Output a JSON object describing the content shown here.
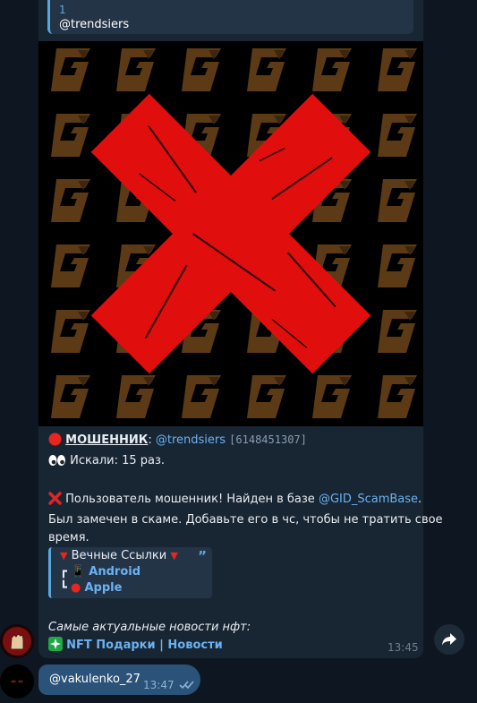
{
  "reply": {
    "number": "1",
    "username": "@trendsiers"
  },
  "image": {
    "icon": "red-x-scam-icon",
    "tile_letter": "G",
    "tile_color": "#5c3a15",
    "x_color": "#e10e0e"
  },
  "message": {
    "line1_label": "МОШЕННИК",
    "line1_colon": ":",
    "line1_user": "@trendsiers",
    "line1_id": "[6148451307]",
    "line2": "Искали: 15 раз.",
    "line3_pre": "Пользователь мошенник! Найден в базе ",
    "line3_link": "@GID_ScamBase",
    "line3_post": ".",
    "line4": "Был замечен в скаме. Добавьте его в чс, чтобы не тратить свое",
    "line5": "время.",
    "quote_title": "Вечные Ссылки",
    "quote_android": "Android",
    "quote_apple": "Apple",
    "news_italic": "Самые актуальные новости нфт:",
    "news_link": "NFT Подарки | Новости",
    "time": "13:45"
  },
  "reply_message": {
    "text": "@vakulenko_27",
    "time": "13:47"
  },
  "colors": {
    "background": "#0e1621",
    "bubble": "#182533",
    "outgoing": "#2b5278",
    "link": "#6ab2f2"
  }
}
